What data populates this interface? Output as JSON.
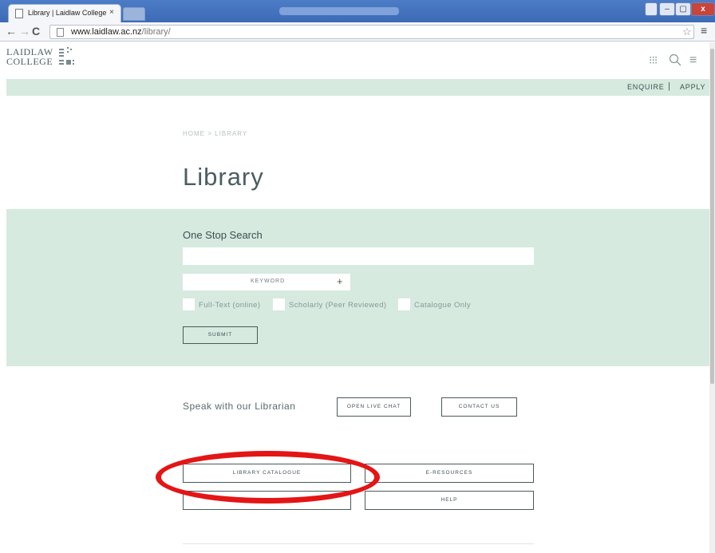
{
  "browser": {
    "tab_title": "Library | Laidlaw College",
    "tab_close": "×",
    "url_host": "www.laidlaw.ac.nz",
    "url_path": "/library/",
    "back": "←",
    "forward": "→",
    "reload": "C",
    "star": "☆",
    "menu": "≡",
    "window_controls": {
      "minimize": "–",
      "maximize": "▢",
      "close": "x"
    }
  },
  "header": {
    "logo_line1": "LAIDLAW",
    "logo_line2": "COLLEGE",
    "grid_icon": "⁝⁝⁝",
    "search_icon": "⚲",
    "menu_icon": "≡"
  },
  "utility": {
    "enquire": "ENQUIRE",
    "separator": "|",
    "apply": "APPLY"
  },
  "breadcrumb": "HOME  >   LIBRARY",
  "page_title": "Library",
  "search": {
    "title": "One Stop Search",
    "input_value": "",
    "keyword_label": "KEYWORD",
    "keyword_plus": "+",
    "options": [
      "Full-Text (online)",
      "Scholarly (Peer Reviewed)",
      "Catalogue Only"
    ],
    "submit": "SUBMIT"
  },
  "librarian": {
    "text": "Speak with our Librarian",
    "live_chat": "OPEN LIVE CHAT",
    "contact": "CONTACT US"
  },
  "resources": {
    "catalogue": "LIBRARY CATALOGUE",
    "eresources": "E-RESOURCES",
    "blank": "",
    "help": "HELP"
  },
  "colors": {
    "accent_green": "#d6eadf",
    "annotation_red": "#e41515",
    "text_dark": "#3e4f51"
  }
}
